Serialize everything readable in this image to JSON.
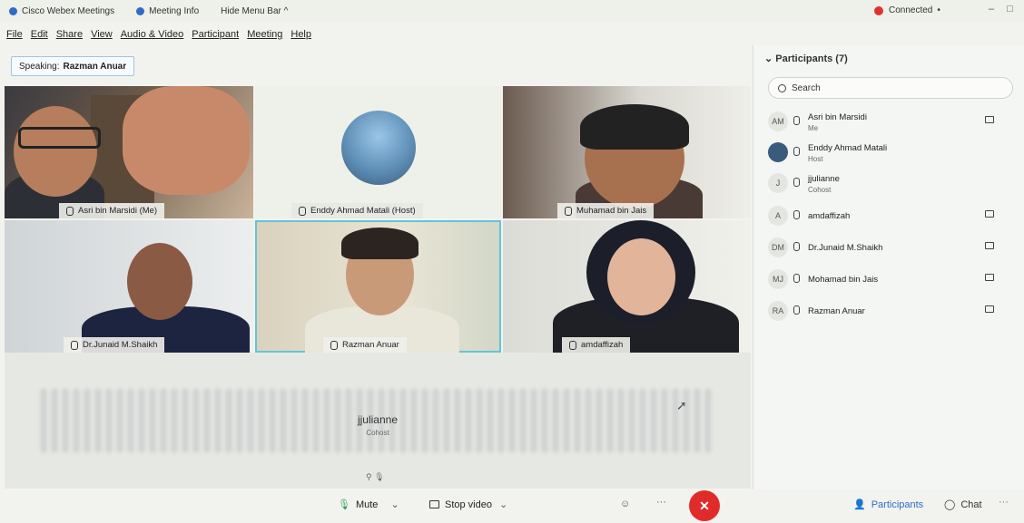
{
  "titlebar": {
    "app_title": "Cisco Webex Meetings",
    "meeting_info": "Meeting Info",
    "hide_menu": "Hide Menu Bar ^",
    "status": "Connected",
    "status_color": "#e0322b",
    "minimize": "–",
    "maximize": "□"
  },
  "menu": {
    "items": [
      "File",
      "Edit",
      "Share",
      "View",
      "Audio & Video",
      "Participant",
      "Meeting",
      "Help"
    ]
  },
  "speaking": {
    "prefix": "Speaking:",
    "name": "Razman Anuar"
  },
  "tiles": [
    {
      "label": "Asri bin Marsidi (Me)"
    },
    {
      "label": "Enddy Ahmad Matali (Host)"
    },
    {
      "label": "Muhamad bin Jais"
    },
    {
      "label": "Dr.Junaid M.Shaikh"
    },
    {
      "label": "Razman Anuar"
    },
    {
      "label": "amdaffizah"
    }
  ],
  "bottom_tile": {
    "name": "jjulianne",
    "role": "Cohost"
  },
  "controls": {
    "mute": "Mute",
    "stop_video": "Stop video",
    "more": "···",
    "end": "✕",
    "participants": "Participants",
    "chat": "Chat",
    "overflow": "···"
  },
  "panel": {
    "title": "Participants (7)",
    "search_placeholder": "Search",
    "participants": [
      {
        "avatar": "AM",
        "name": "Asri bin Marsidi",
        "role": "Me"
      },
      {
        "avatar": "",
        "name": "Enddy Ahmad Matali",
        "role": "Host"
      },
      {
        "avatar": "J",
        "name": "jjulianne",
        "role": "Cohost"
      },
      {
        "avatar": "A",
        "name": "amdaffizah",
        "role": ""
      },
      {
        "avatar": "DM",
        "name": "Dr.Junaid M.Shaikh",
        "role": ""
      },
      {
        "avatar": "MJ",
        "name": "Mohamad bin Jais",
        "role": ""
      },
      {
        "avatar": "RA",
        "name": "Razman Anuar",
        "role": ""
      }
    ]
  },
  "colors": {
    "accent": "#2e6cc9",
    "end_button": "#e12b2b",
    "selected_tile": "#66c3d8"
  }
}
